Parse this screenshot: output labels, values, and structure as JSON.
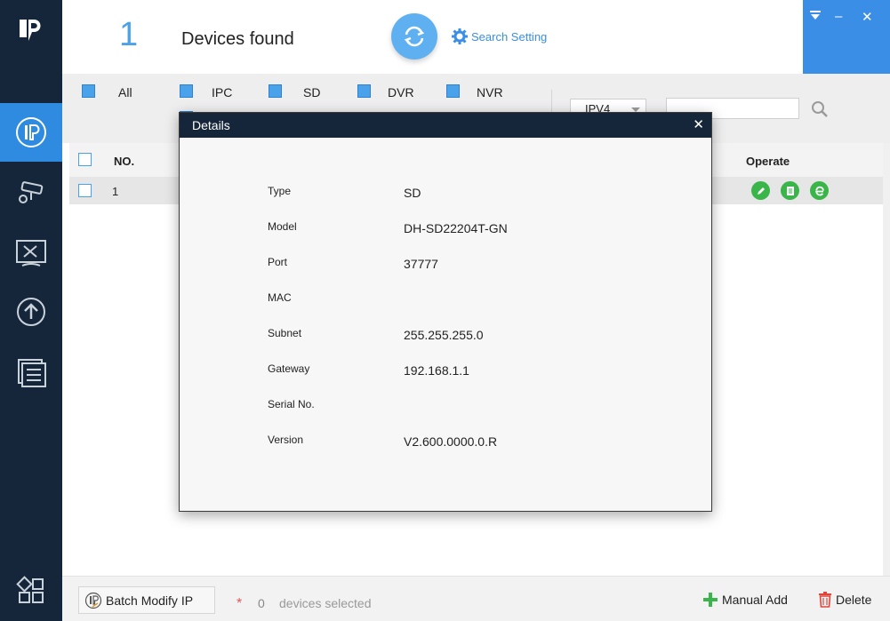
{
  "header": {
    "device_count": "1",
    "devices_found_label": "Devices found",
    "search_setting_label": "Search Setting",
    "minimize_glyph": "–",
    "close_glyph": "✕"
  },
  "filters": {
    "all": "All",
    "ipc": "IPC",
    "sd": "SD",
    "dvr": "DVR",
    "nvr": "NVR",
    "ip_version": "IPV4",
    "search_value": ""
  },
  "table": {
    "col_no": "NO.",
    "col_operate": "Operate",
    "rows": [
      {
        "no": "1"
      }
    ]
  },
  "dialog": {
    "title": "Details",
    "close": "✕",
    "fields": [
      {
        "label": "Type",
        "value": "SD"
      },
      {
        "label": "Model",
        "value": "DH-SD22204T-GN"
      },
      {
        "label": "Port",
        "value": "37777"
      },
      {
        "label": "MAC",
        "value": ""
      },
      {
        "label": "Subnet",
        "value": "255.255.255.0"
      },
      {
        "label": "Gateway",
        "value": "192.168.1.1"
      },
      {
        "label": "Serial No.",
        "value": ""
      },
      {
        "label": "Version",
        "value": "V2.600.0000.0.R"
      }
    ]
  },
  "footer": {
    "batch_modify_ip": "Batch Modify IP",
    "star": "*",
    "selected_count": "0",
    "devices_selected": "devices selected",
    "manual_add": "Manual Add",
    "delete": "Delete"
  },
  "colors": {
    "sidebar": "#16263a",
    "accent": "#3a8ee6",
    "operate_green": "#3ab54a"
  },
  "icons": {
    "sidebar": [
      "ip-icon",
      "camera-config-icon",
      "tools-icon",
      "upgrade-icon",
      "document-list-icon",
      "apps-icon"
    ],
    "operate": [
      "edit-icon",
      "details-icon",
      "web-browser-icon"
    ]
  }
}
